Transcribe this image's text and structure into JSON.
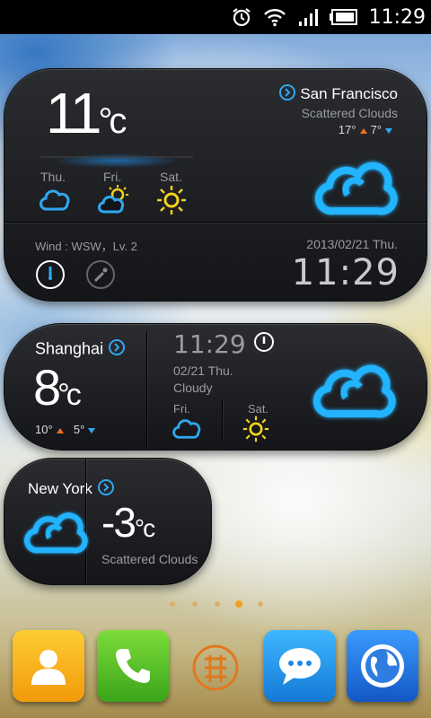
{
  "status_bar": {
    "time": "11:29",
    "icons": [
      "alarm-icon",
      "wifi-icon",
      "signal-icon",
      "battery-icon"
    ]
  },
  "widget_main": {
    "temperature": "11",
    "unit": "°c",
    "city": "San Francisco",
    "condition": "Scattered Clouds",
    "high": "17°",
    "low": "7°",
    "forecast": [
      {
        "day": "Thu.",
        "icon": "cloud-icon"
      },
      {
        "day": "Fri.",
        "icon": "partly-sunny-icon"
      },
      {
        "day": "Sat.",
        "icon": "sun-icon"
      }
    ],
    "wind": "Wind : WSW，Lv. 2",
    "date": "2013/02/21  Thu.",
    "clock": "11:29"
  },
  "widget_shanghai": {
    "city": "Shanghai",
    "temperature": "8",
    "unit": "°c",
    "high": "10°",
    "low": "5°",
    "clock": "11:29",
    "date": "02/21 Thu.",
    "condition": "Cloudy",
    "forecast": [
      {
        "day": "Fri.",
        "icon": "cloud-icon"
      },
      {
        "day": "Sat.",
        "icon": "sun-icon"
      }
    ]
  },
  "widget_newyork": {
    "city": "New York",
    "temperature": "-3",
    "unit": "°c",
    "condition": "Scattered Clouds"
  },
  "page_indicator": {
    "count": 5,
    "active": 4
  },
  "dock": [
    "contacts-icon",
    "phone-icon",
    "fortune-icon",
    "messaging-icon",
    "browser-icon"
  ],
  "colors": {
    "accent": "#2fa8f0",
    "sun": "#f2d21c",
    "high_arrow": "#f07020"
  }
}
